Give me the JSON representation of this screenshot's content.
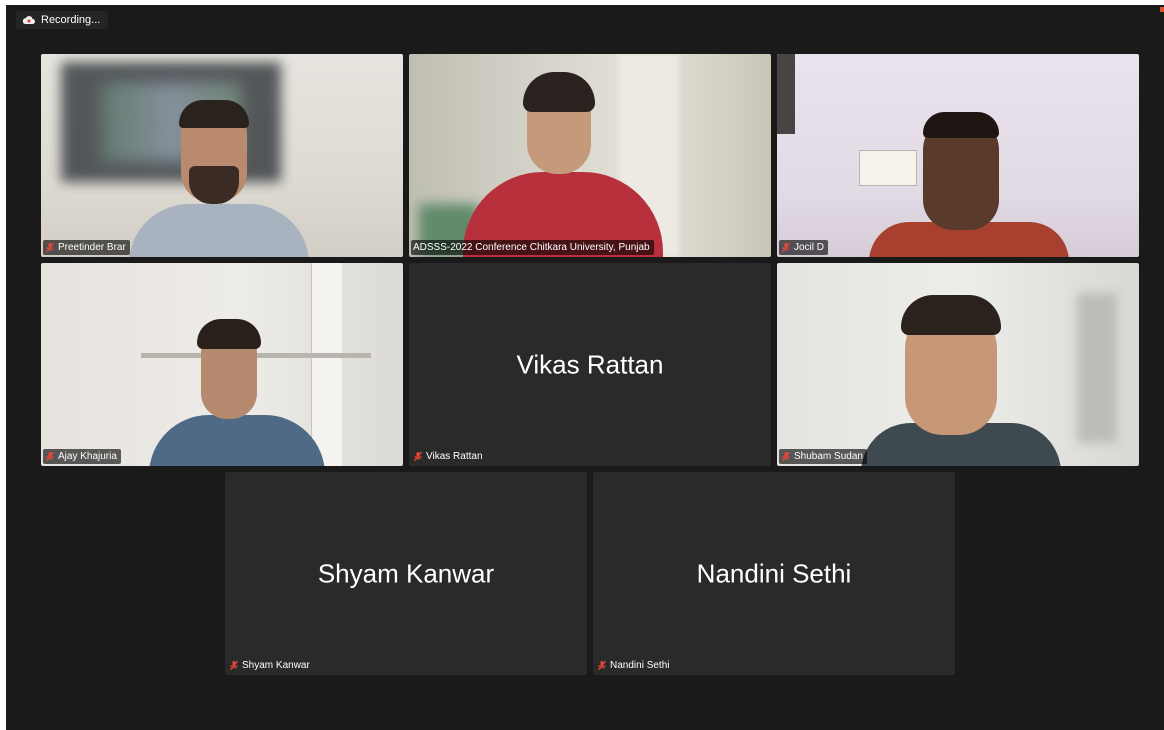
{
  "recording": {
    "label": "Recording..."
  },
  "participants": [
    {
      "name": "Preetinder Brar",
      "video": true,
      "muted": true,
      "active_speaker": true
    },
    {
      "name": "ADSSS-2022 Conference Chitkara University, Punjab",
      "video": true,
      "muted": false
    },
    {
      "name": "Jocil D",
      "video": true,
      "muted": true
    },
    {
      "name": "Ajay Khajuria",
      "video": true,
      "muted": true
    },
    {
      "name": "Vikas Rattan",
      "video": false,
      "muted": true,
      "display_text": "Vikas Rattan"
    },
    {
      "name": "Shubam Sudan",
      "video": true,
      "muted": true
    },
    {
      "name": "Shyam Kanwar",
      "video": false,
      "muted": true,
      "display_text": "Shyam Kanwar"
    },
    {
      "name": "Nandini Sethi",
      "video": false,
      "muted": true,
      "display_text": "Nandini Sethi"
    }
  ],
  "colors": {
    "background": "#1a1a1a",
    "tile": "#2a2a2a",
    "active_border": "#2ecc40",
    "muted_icon": "#e8473a"
  },
  "icons": {
    "recording": "cloud-record-icon",
    "muted": "mic-muted-icon"
  }
}
